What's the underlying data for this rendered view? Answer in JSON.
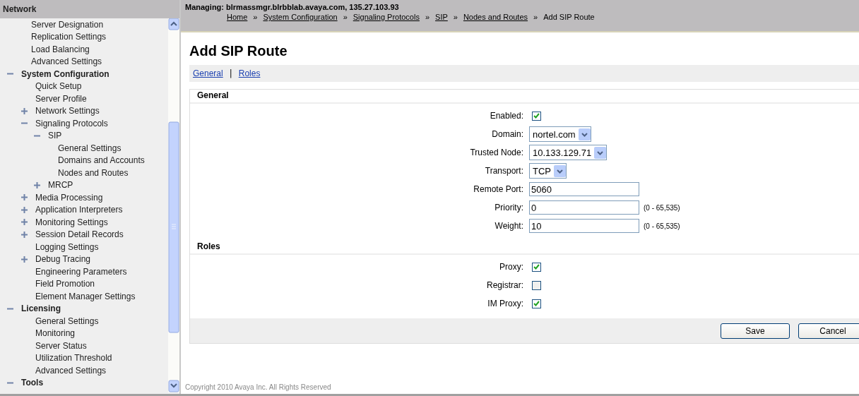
{
  "sidebar": {
    "title": "Network",
    "cut_items": [
      {
        "label": "Server Designation"
      },
      {
        "label": "Replication Settings"
      },
      {
        "label": "Load Balancing"
      },
      {
        "label": "Advanced Settings"
      }
    ],
    "items": [
      {
        "label": "System Configuration",
        "expanded": true,
        "children": [
          {
            "label": "Quick Setup"
          },
          {
            "label": "Server Profile"
          },
          {
            "label": "Network Settings",
            "expanded": false
          },
          {
            "label": "Signaling Protocols",
            "expanded": true,
            "children": [
              {
                "label": "SIP",
                "expanded": true,
                "children": [
                  {
                    "label": "General Settings"
                  },
                  {
                    "label": "Domains and Accounts"
                  },
                  {
                    "label": "Nodes and Routes"
                  }
                ]
              },
              {
                "label": "MRCP",
                "expanded": false
              }
            ]
          },
          {
            "label": "Media Processing",
            "expanded": false
          },
          {
            "label": "Application Interpreters",
            "expanded": false
          },
          {
            "label": "Monitoring Settings",
            "expanded": false
          },
          {
            "label": "Session Detail Records",
            "expanded": false
          },
          {
            "label": "Logging Settings"
          },
          {
            "label": "Debug Tracing",
            "expanded": false
          },
          {
            "label": "Engineering Parameters"
          },
          {
            "label": "Field Promotion"
          },
          {
            "label": "Element Manager Settings"
          }
        ]
      },
      {
        "label": "Licensing",
        "expanded": true,
        "children": [
          {
            "label": "General Settings"
          },
          {
            "label": "Monitoring"
          },
          {
            "label": "Server Status"
          },
          {
            "label": "Utilization Threshold"
          },
          {
            "label": "Advanced Settings"
          }
        ]
      },
      {
        "label": "Tools",
        "expanded": true
      }
    ]
  },
  "header": {
    "managing": "Managing: blrmassmgr.blrbblab.avaya.com, 135.27.103.93",
    "breadcrumb": [
      {
        "label": "Home",
        "link": true
      },
      {
        "label": "System Configuration",
        "link": true
      },
      {
        "label": "Signaling Protocols",
        "link": true
      },
      {
        "label": "SIP",
        "link": true
      },
      {
        "label": "Nodes and Routes",
        "link": true
      },
      {
        "label": "Add SIP Route",
        "link": false
      }
    ],
    "separator": "»"
  },
  "page_title": "Add SIP Route",
  "tab_links": {
    "items": [
      "General",
      "Roles"
    ],
    "separator": "|"
  },
  "sections": [
    {
      "title": "General",
      "fields": [
        {
          "kind": "checkbox",
          "label": "Enabled:",
          "checked": true
        },
        {
          "kind": "select",
          "label": "Domain:",
          "value": "nortel.com"
        },
        {
          "kind": "select",
          "label": "Trusted Node:",
          "value": "10.133.129.71"
        },
        {
          "kind": "select",
          "label": "Transport:",
          "value": "TCP"
        },
        {
          "kind": "text",
          "label": "Remote Port:",
          "value": "5060"
        },
        {
          "kind": "text",
          "label": "Priority:",
          "value": "0",
          "hint": "(0 - 65,535)"
        },
        {
          "kind": "text",
          "label": "Weight:",
          "value": "10",
          "hint": "(0 - 65,535)"
        }
      ]
    },
    {
      "title": "Roles",
      "fields": [
        {
          "kind": "checkbox",
          "label": "Proxy:",
          "checked": true
        },
        {
          "kind": "checkbox",
          "label": "Registrar:",
          "checked": false
        },
        {
          "kind": "checkbox",
          "label": "IM Proxy:",
          "checked": true
        }
      ]
    }
  ],
  "buttons": [
    "Save",
    "Cancel"
  ],
  "footer": "Copyright 2010 Avaya Inc. All Rights Reserved"
}
